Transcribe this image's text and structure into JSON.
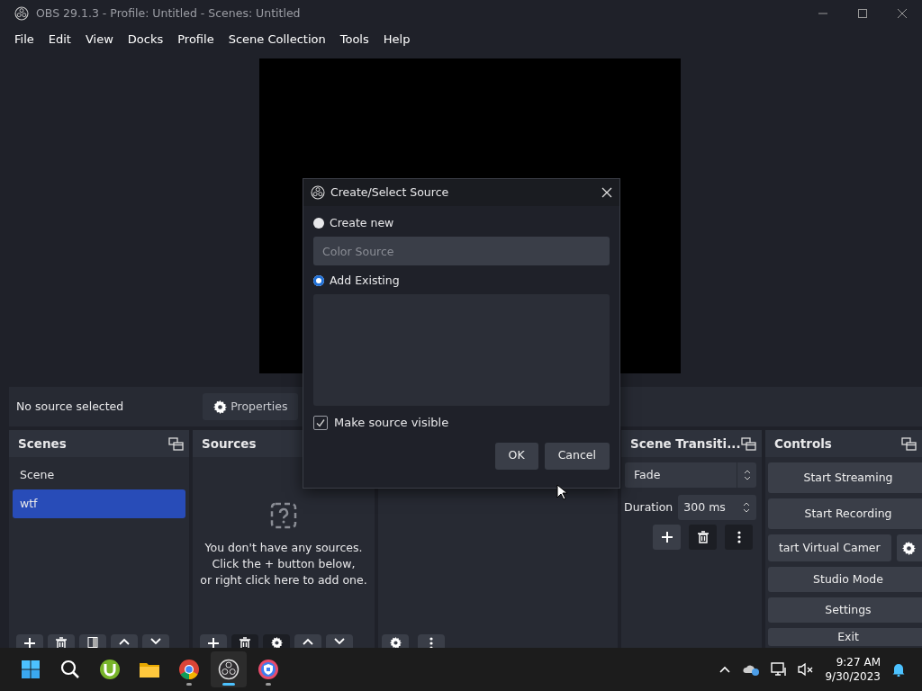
{
  "window": {
    "title": "OBS 29.1.3 - Profile: Untitled - Scenes: Untitled"
  },
  "menu": [
    "File",
    "Edit",
    "View",
    "Docks",
    "Profile",
    "Scene Collection",
    "Tools",
    "Help"
  ],
  "source_toolbar": {
    "status": "No source selected",
    "properties_button": "Properties"
  },
  "scenes": {
    "title": "Scenes",
    "items": [
      {
        "label": "Scene",
        "selected": false
      },
      {
        "label": "wtf",
        "selected": true
      }
    ]
  },
  "sources": {
    "title": "Sources",
    "empty_message": [
      "You don't have any sources.",
      "Click the + button below,",
      "or right click here to add one."
    ]
  },
  "transitions": {
    "title": "Scene Transiti...",
    "transition": "Fade",
    "duration_label": "Duration",
    "duration": "300 ms"
  },
  "controls": {
    "title": "Controls",
    "buttons": [
      {
        "label": "Start Streaming",
        "kind": "button"
      },
      {
        "label": "Start Recording",
        "kind": "button"
      },
      {
        "label": "tart Virtual Camer",
        "kind": "with_settings"
      },
      {
        "label": "Studio Mode",
        "kind": "button"
      },
      {
        "label": "Settings",
        "kind": "button"
      },
      {
        "label": "Exit",
        "kind": "button"
      }
    ]
  },
  "dialog": {
    "title": "Create/Select Source",
    "options": [
      {
        "label": "Create new",
        "selected": false
      },
      {
        "label": "Add Existing",
        "selected": true
      }
    ],
    "name_placeholder": "Color Source",
    "make_visible": {
      "label": "Make source visible",
      "checked": true
    },
    "buttons": [
      "OK",
      "Cancel"
    ]
  },
  "taskbar": {
    "apps": [
      {
        "kind": "start",
        "running": false,
        "selected": false
      },
      {
        "kind": "search",
        "running": false,
        "selected": false
      },
      {
        "kind": "torrent",
        "running": false,
        "selected": false
      },
      {
        "kind": "folder",
        "running": false,
        "selected": false
      },
      {
        "kind": "browser",
        "running": true,
        "selected": false
      },
      {
        "kind": "recorder",
        "running": true,
        "selected": true
      },
      {
        "kind": "vpn",
        "running": true,
        "selected": false
      }
    ],
    "time": "9:27 AM",
    "date": "9/30/2023"
  }
}
